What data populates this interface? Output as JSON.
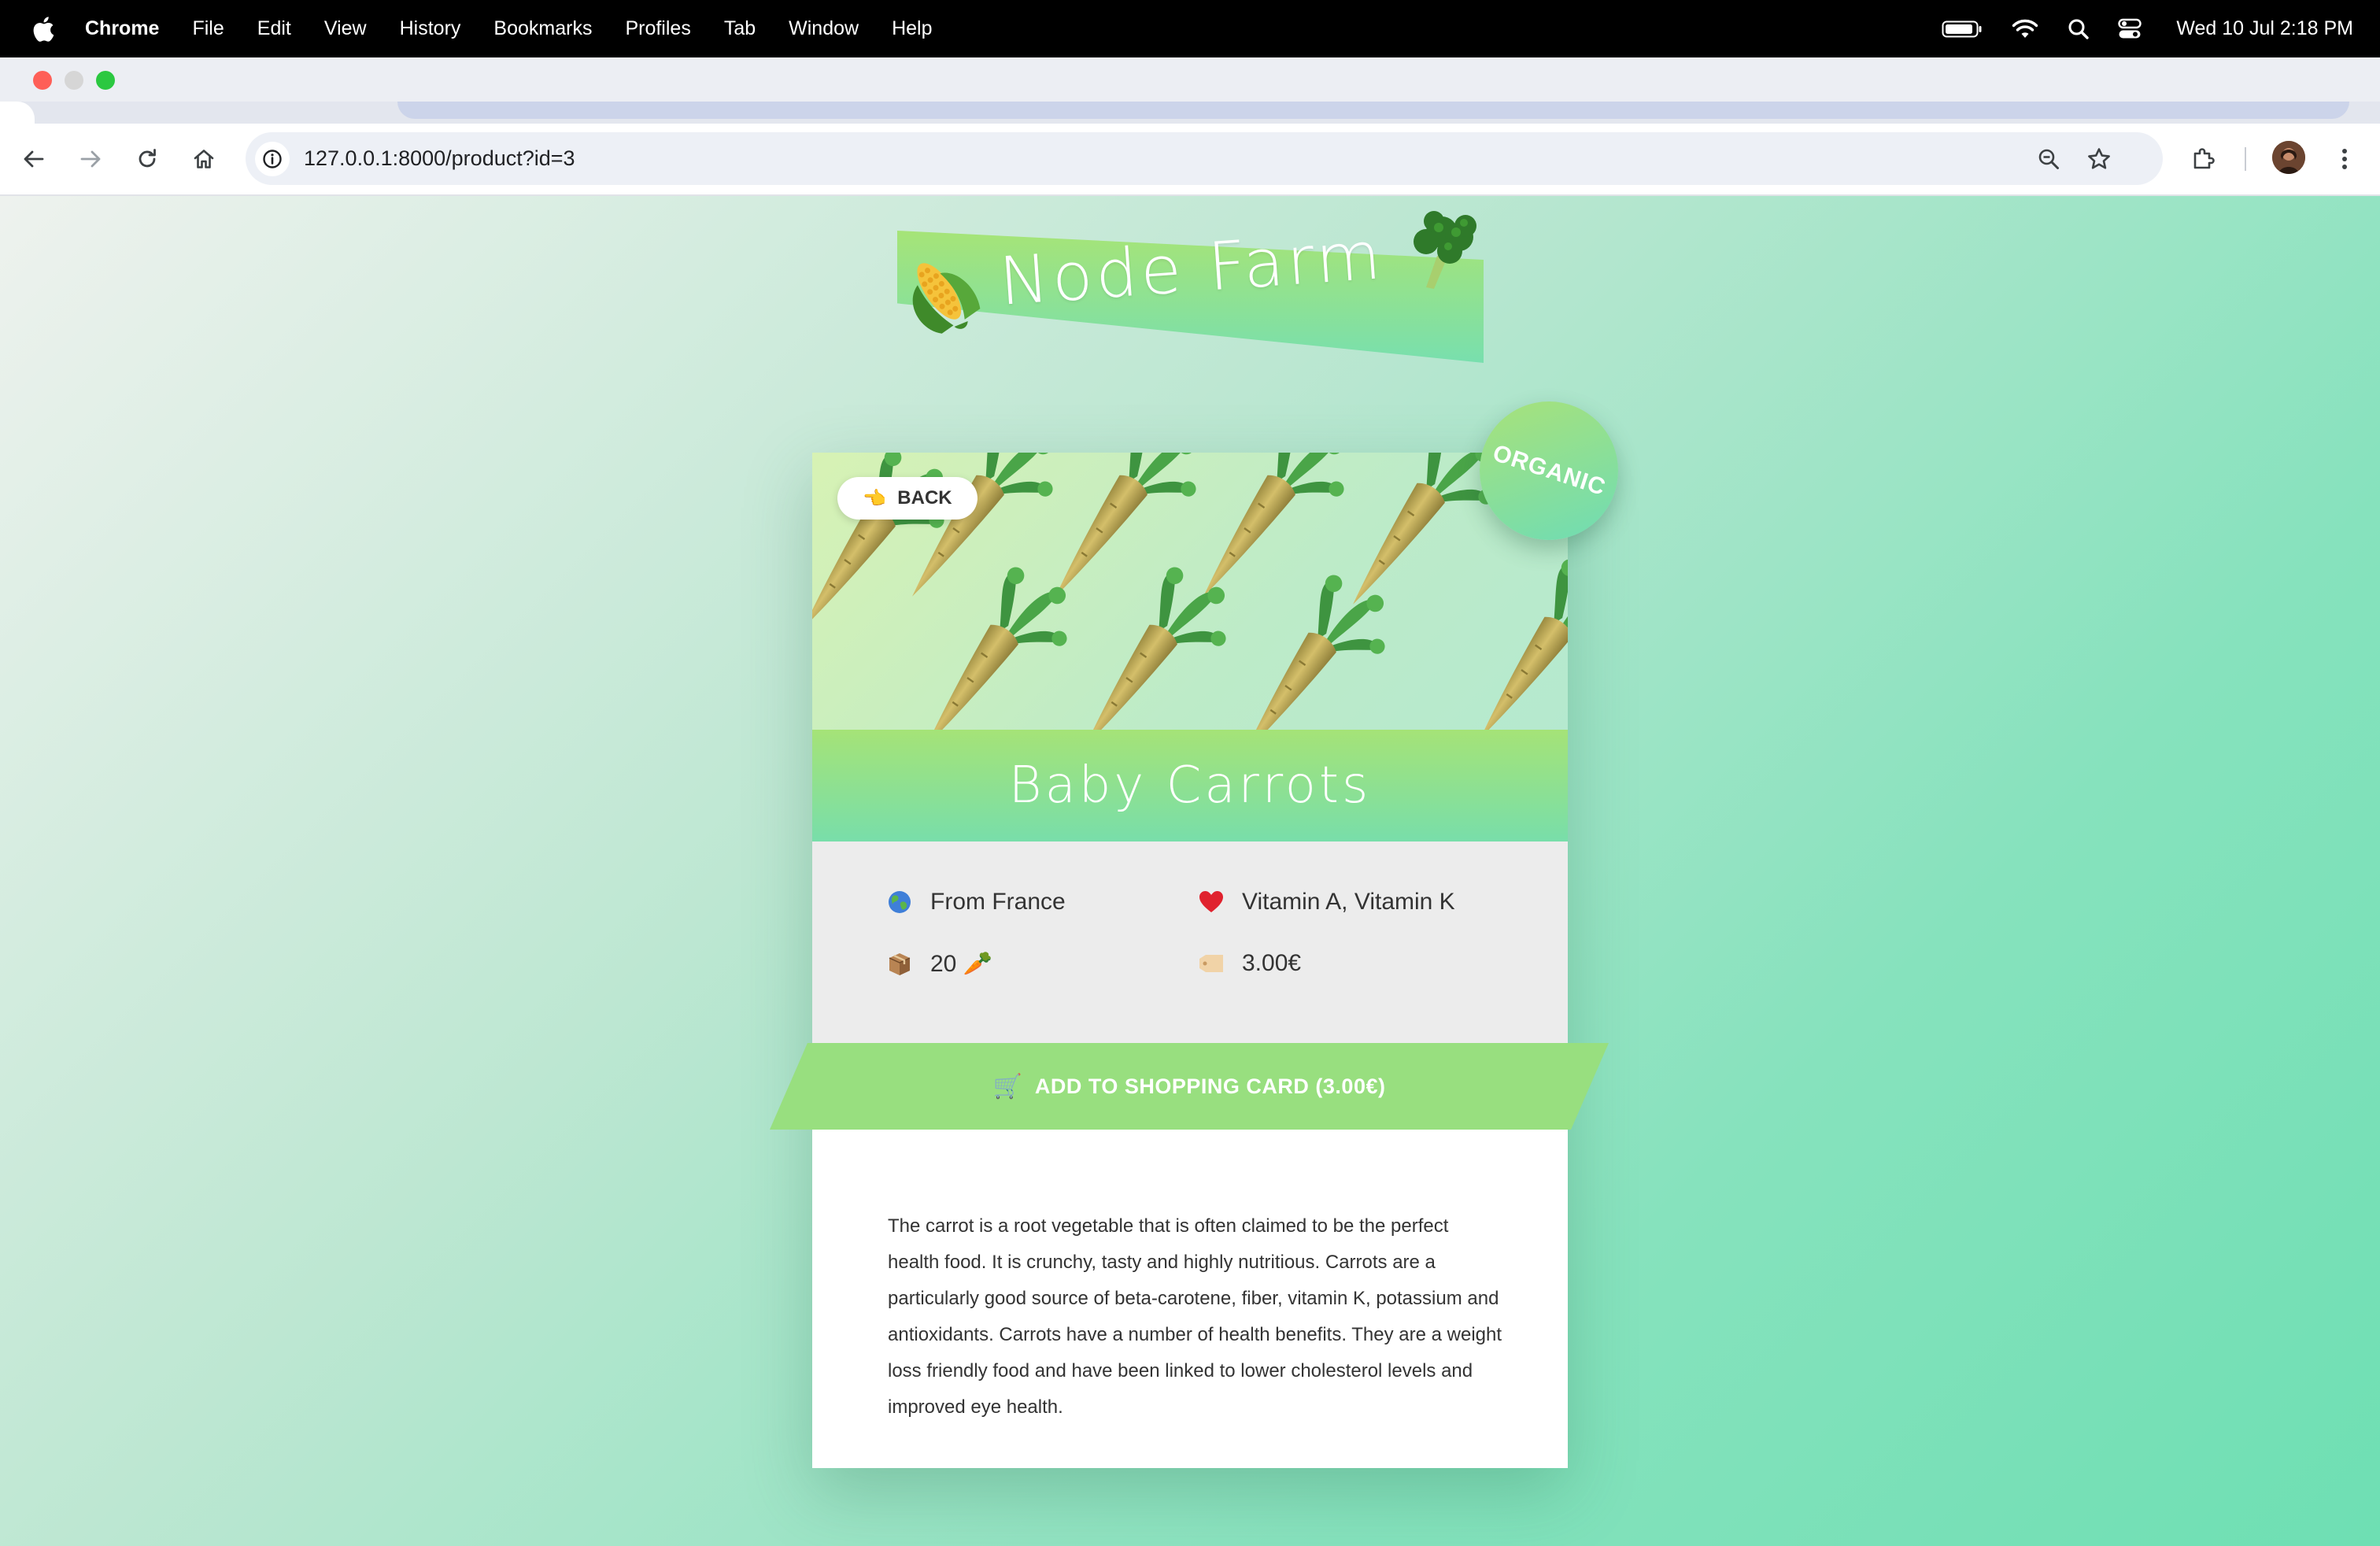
{
  "menubar": {
    "app_name": "Chrome",
    "items": [
      "File",
      "Edit",
      "View",
      "History",
      "Bookmarks",
      "Profiles",
      "Tab",
      "Window",
      "Help"
    ],
    "clock": "Wed 10 Jul  2:18 PM"
  },
  "browser": {
    "url": "127.0.0.1:8000/product?id=3"
  },
  "site": {
    "logo_text": "Node Farm",
    "logo_emojis": [
      "🌽",
      "🥦"
    ]
  },
  "product": {
    "back_label": "BACK",
    "back_icon": "👈",
    "badge": "ORGANIC",
    "name": "Baby Carrots",
    "hero_emoji": "🥕",
    "from": "From France",
    "from_icon": "🌍",
    "nutrients": "Vitamin A, Vitamin K",
    "nutrients_icon": "❤️",
    "quantity": "20 🥕",
    "quantity_icon": "📦",
    "price": "3.00€",
    "price_icon": "🏷️",
    "add_button": "ADD TO SHOPPING CARD (3.00€)",
    "cart_icon": "🛒",
    "description": "The carrot is a root vegetable that is often claimed to be the perfect health food. It is crunchy, tasty and highly nutritious. Carrots are a particularly good source of beta-carotene, fiber, vitamin K, potassium and antioxidants. Carrots have a number of health benefits. They are a weight loss friendly food and have been linked to lower cholesterol levels and improved eye health."
  },
  "colors": {
    "accent_green": "#98df7f",
    "gradient_start": "#a6e477",
    "gradient_end": "#6edfb3"
  }
}
